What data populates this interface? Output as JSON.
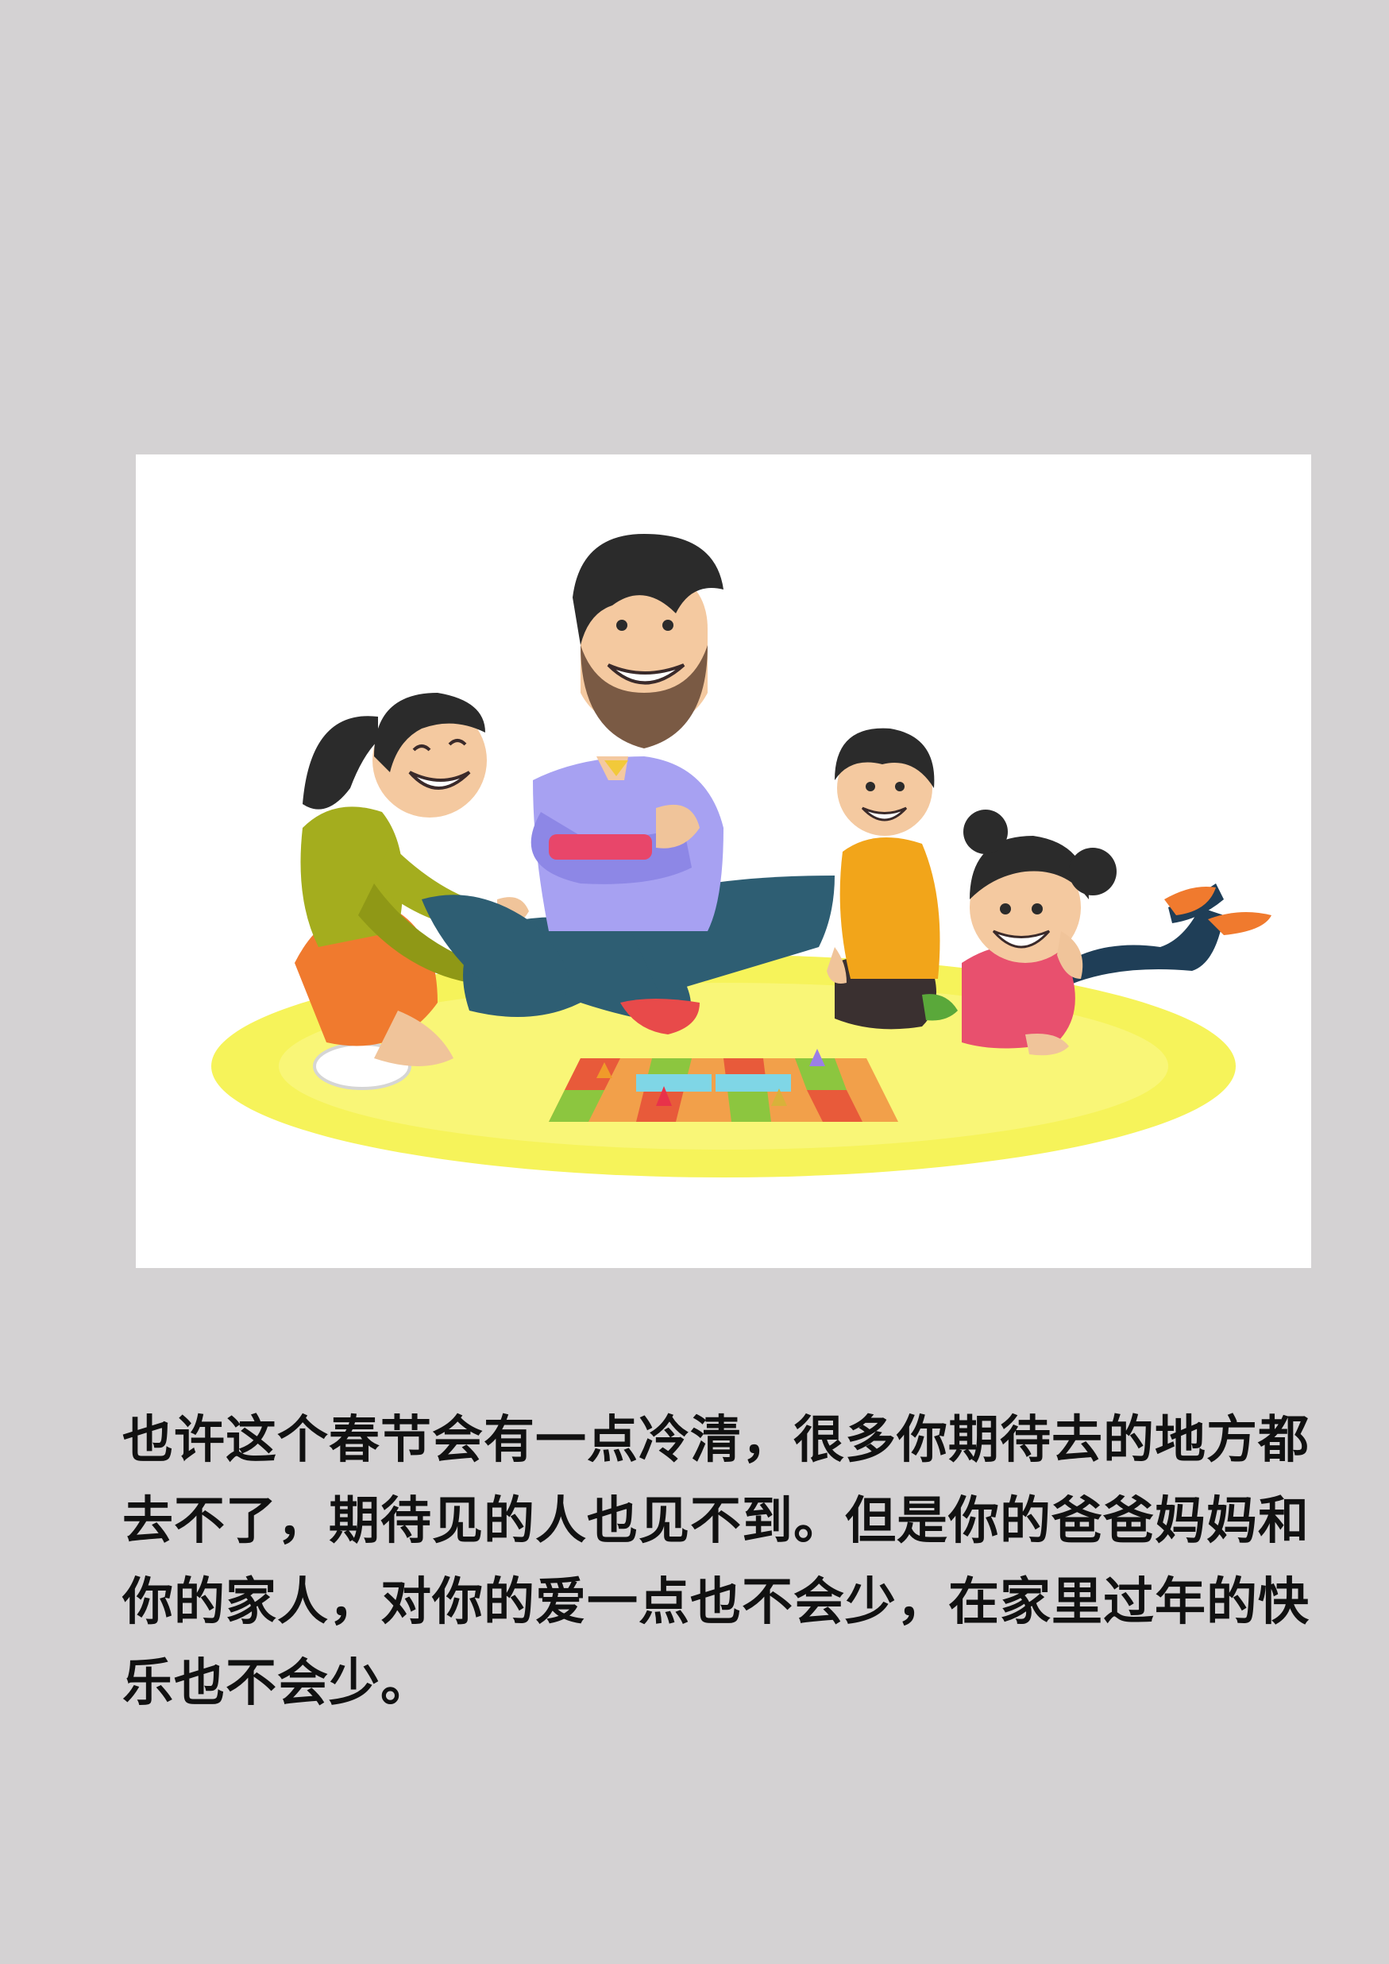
{
  "page": {
    "background_color": "#d4d2d3",
    "illustration": {
      "icon": "family-playing-board-game-illustration",
      "background_color": "#ffffff"
    },
    "body_text": "也许这个春节会有一点冷清，很多你期待去的地方都去不了，期待见的人也见不到。但是你的爸爸妈妈和你的家人，对你的爱一点也不会少，在家里过年的快乐也不会少。"
  }
}
